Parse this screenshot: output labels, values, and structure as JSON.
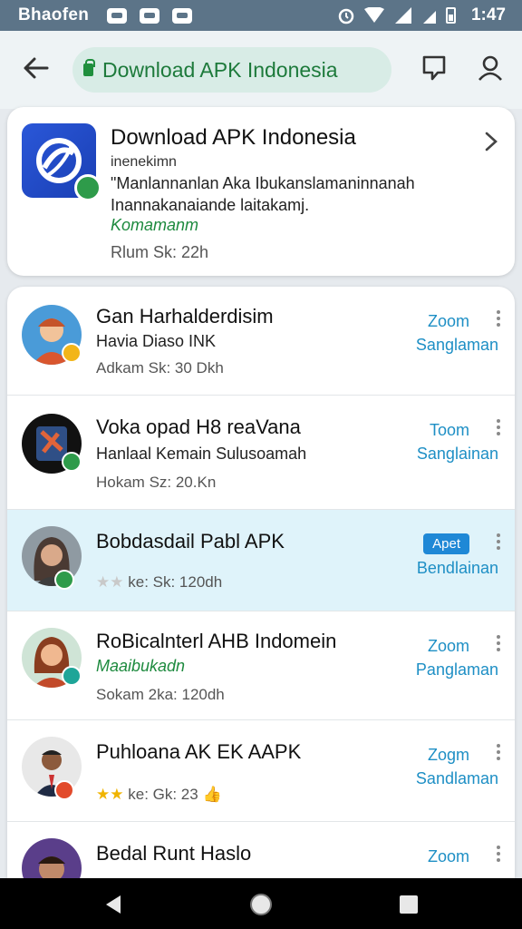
{
  "status_bar": {
    "carrier": "Bhaofen",
    "time": "1:47"
  },
  "toolbar": {
    "url": "Download APK Indonesia",
    "icons": [
      "back-arrow-icon",
      "lock-icon",
      "comment-icon",
      "profile-icon"
    ]
  },
  "featured": {
    "title": "Download APK Indonesia",
    "subtitle": "inenekimn",
    "desc_line1": "\"Manlannanlan Aka Ibukanslamaninnanah",
    "desc_line2": "Inannakanaiande laitakamj.",
    "category": "Komamanm",
    "meta": "Rlum Sk: 22h"
  },
  "list": [
    {
      "name": "Gan Harhalderdisim",
      "line2": "Havia Diaso INK",
      "line3": "Adkam Sk: 30 Dkh",
      "action_primary": "Zoom",
      "action_secondary": "Sanglaman",
      "badge_color": "#f2b518"
    },
    {
      "name": "Voka opad H8 reaVana",
      "line2": "Hanlaal Kemain Sulusoamah",
      "line3": "Hokam Sz: 20.Kn",
      "action_primary": "Toom",
      "action_secondary": "Sanglainan",
      "badge_color": "#2e9b4a"
    },
    {
      "name": "Bobdasdail Pabl APK",
      "line2": "",
      "line3": "ke: Sk: 120dh",
      "action_primary": "Apet",
      "action_secondary": "Bendlainan",
      "badge_color": "#2e9b4a",
      "rating_stars": 2
    },
    {
      "name": "RoBicalnterl AHB Indomein",
      "line2": "Maaibukadn",
      "line3": "Sokam 2ka: 120dh",
      "action_primary": "Zoom",
      "action_secondary": "Panglaman",
      "badge_color": "#1ea598"
    },
    {
      "name": "Puhloana AK EK AAPK",
      "line2": "",
      "line3": "ke: Gk: 23",
      "action_primary": "Zogm",
      "action_secondary": "Sandlaman",
      "badge_color": "#e24a2b",
      "rating_stars": 2
    },
    {
      "name": "Bedal Runt Haslo",
      "line2": "",
      "line3": "",
      "action_primary": "Zoom",
      "action_secondary": "",
      "badge_color": ""
    }
  ],
  "colors": {
    "status_bar": "#5c7488",
    "accent_green": "#1d7a3b",
    "action_blue": "#1e8fc5",
    "active_row": "#dff3fa"
  }
}
